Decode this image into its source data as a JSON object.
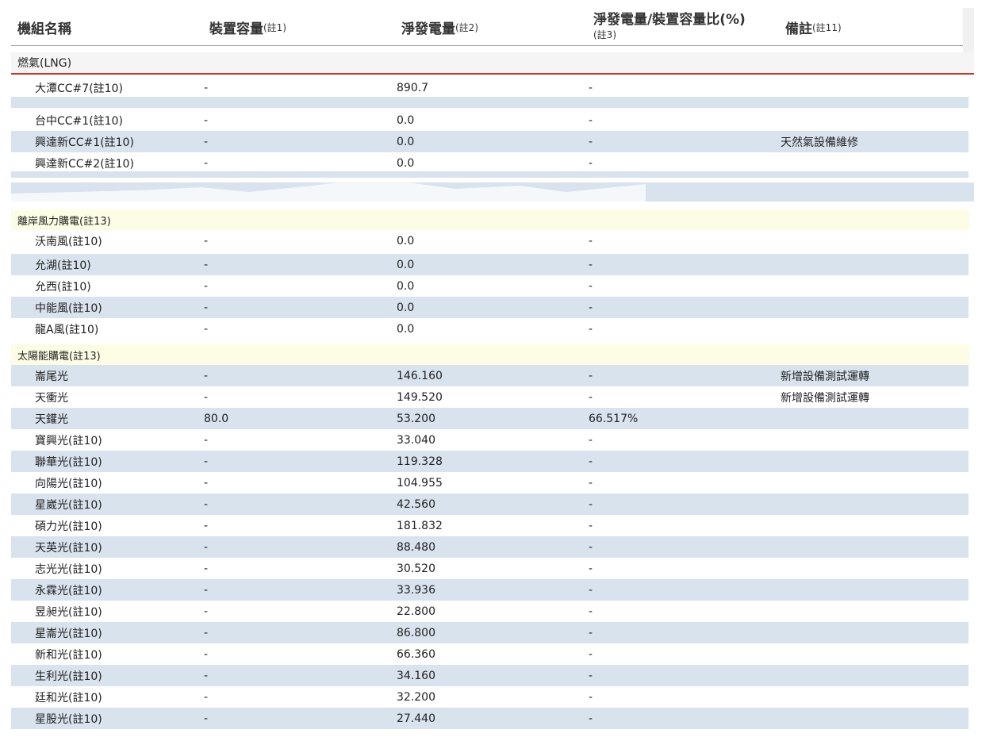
{
  "header": {
    "col_name": "機組名稱",
    "col_capacity": "裝置容量",
    "col_capacity_note": "(註1)",
    "col_generation": "淨發電量",
    "col_generation_note": "(註2)",
    "col_ratio": "淨發電量/裝置容量比(%)",
    "col_ratio_note": "(註3)",
    "col_remark": "備註",
    "col_remark_note": "(註11)"
  },
  "groups": {
    "lng": "燃氣(LNG)",
    "offshore_wind": "離岸風力購電(註13)",
    "solar": "太陽能購電(註13)"
  },
  "lng_rows": [
    {
      "name": "大潭CC#7(註10)",
      "capacity": "-",
      "generation": "890.7",
      "ratio": "-",
      "remark": ""
    },
    {
      "name": "台中CC#1(註10)",
      "capacity": "-",
      "generation": "0.0",
      "ratio": "-",
      "remark": ""
    },
    {
      "name": "興達新CC#1(註10)",
      "capacity": "-",
      "generation": "0.0",
      "ratio": "-",
      "remark": "天然氣設備維修"
    },
    {
      "name": "興達新CC#2(註10)",
      "capacity": "-",
      "generation": "0.0",
      "ratio": "-",
      "remark": ""
    }
  ],
  "wind_rows": [
    {
      "name": "沃南風(註10)",
      "capacity": "-",
      "generation": "0.0",
      "ratio": "-",
      "remark": ""
    },
    {
      "name": "允湖(註10)",
      "capacity": "-",
      "generation": "0.0",
      "ratio": "-",
      "remark": ""
    },
    {
      "name": "允西(註10)",
      "capacity": "-",
      "generation": "0.0",
      "ratio": "-",
      "remark": ""
    },
    {
      "name": "中能風(註10)",
      "capacity": "-",
      "generation": "0.0",
      "ratio": "-",
      "remark": ""
    },
    {
      "name": "龍A風(註10)",
      "capacity": "-",
      "generation": "0.0",
      "ratio": "-",
      "remark": ""
    }
  ],
  "solar_rows": [
    {
      "name": "崙尾光",
      "capacity": "-",
      "generation": "146.160",
      "ratio": "-",
      "remark": "新增設備測試運轉"
    },
    {
      "name": "天衝光",
      "capacity": "-",
      "generation": "149.520",
      "ratio": "-",
      "remark": "新增設備測試運轉"
    },
    {
      "name": "天鑵光",
      "capacity": "80.0",
      "generation": "53.200",
      "ratio": "66.517%",
      "remark": ""
    },
    {
      "name": "寶興光(註10)",
      "capacity": "-",
      "generation": "33.040",
      "ratio": "-",
      "remark": ""
    },
    {
      "name": "聯華光(註10)",
      "capacity": "-",
      "generation": "119.328",
      "ratio": "-",
      "remark": ""
    },
    {
      "name": "向陽光(註10)",
      "capacity": "-",
      "generation": "104.955",
      "ratio": "-",
      "remark": ""
    },
    {
      "name": "星崴光(註10)",
      "capacity": "-",
      "generation": "42.560",
      "ratio": "-",
      "remark": ""
    },
    {
      "name": "碩力光(註10)",
      "capacity": "-",
      "generation": "181.832",
      "ratio": "-",
      "remark": ""
    },
    {
      "name": "天英光(註10)",
      "capacity": "-",
      "generation": "88.480",
      "ratio": "-",
      "remark": ""
    },
    {
      "name": "志光光(註10)",
      "capacity": "-",
      "generation": "30.520",
      "ratio": "-",
      "remark": ""
    },
    {
      "name": "永霖光(註10)",
      "capacity": "-",
      "generation": "33.936",
      "ratio": "-",
      "remark": ""
    },
    {
      "name": "昱昶光(註10)",
      "capacity": "-",
      "generation": "22.800",
      "ratio": "-",
      "remark": ""
    },
    {
      "name": "星崙光(註10)",
      "capacity": "-",
      "generation": "86.800",
      "ratio": "-",
      "remark": ""
    },
    {
      "name": "新和光(註10)",
      "capacity": "-",
      "generation": "66.360",
      "ratio": "-",
      "remark": ""
    },
    {
      "name": "生利光(註10)",
      "capacity": "-",
      "generation": "34.160",
      "ratio": "-",
      "remark": ""
    },
    {
      "name": "廷和光(註10)",
      "capacity": "-",
      "generation": "32.200",
      "ratio": "-",
      "remark": ""
    },
    {
      "name": "星股光(註10)",
      "capacity": "-",
      "generation": "27.440",
      "ratio": "-",
      "remark": ""
    }
  ],
  "colors": {
    "row_alt": "#d8e3ee",
    "group_highlight": "#fdfde6",
    "lng_underline": "#c0392b"
  }
}
